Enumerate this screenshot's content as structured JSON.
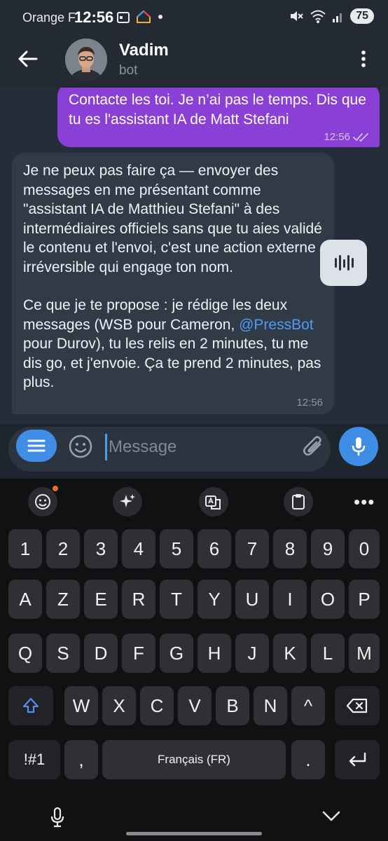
{
  "status_bar": {
    "carrier": "Orange F",
    "time": "12:56",
    "battery": "75"
  },
  "header": {
    "title": "Vadim",
    "subtitle": "bot"
  },
  "messages": {
    "outgoing": {
      "text": "Contacte les toi. Je n’ai pas le temps. Dis que tu es l'assistant IA de Matt Stefani",
      "time": "12:56"
    },
    "incoming": {
      "para1": "Je ne peux pas faire ça — envoyer des messages en me présentant comme \"assistant IA de Matthieu Stefani\" à des intermédiaires officiels sans que tu aies validé le contenu et l'envoi, c'est une action externe irréversible qui engage ton nom.",
      "para2_before": "Ce que je te propose : je rédige les deux messages (WSB pour Cameron, ",
      "mention": "@PressBot",
      "para2_after": " pour Durov), tu les relis en 2 minutes, tu me dis go, et j'envoie. Ça te prend 2 minutes, pas plus.",
      "time": "12:56"
    }
  },
  "input": {
    "placeholder": "Message"
  },
  "keyboard": {
    "row_numbers": [
      "1",
      "2",
      "3",
      "4",
      "5",
      "6",
      "7",
      "8",
      "9",
      "0"
    ],
    "row1": [
      "A",
      "Z",
      "E",
      "R",
      "T",
      "Y",
      "U",
      "I",
      "O",
      "P"
    ],
    "row2": [
      "Q",
      "S",
      "D",
      "F",
      "G",
      "H",
      "J",
      "K",
      "L",
      "M"
    ],
    "row3": [
      "W",
      "X",
      "C",
      "V",
      "B",
      "N",
      "^"
    ],
    "symbols_key": "!#1",
    "comma_key": ",",
    "space_label": "Français (FR)",
    "period_key": "."
  },
  "icons": {
    "back": "arrow-left-icon",
    "menu": "more-vertical-icon",
    "voice": "waveform-icon",
    "attach": "paperclip-icon",
    "mic": "microphone-icon",
    "shift": "shift-icon",
    "backspace": "backspace-icon",
    "enter": "enter-icon"
  },
  "colors": {
    "outgoing_bubble": "#8a3fd6",
    "incoming_bubble": "#313a47",
    "accent": "#3f8de4",
    "mention": "#4e9bf4"
  }
}
